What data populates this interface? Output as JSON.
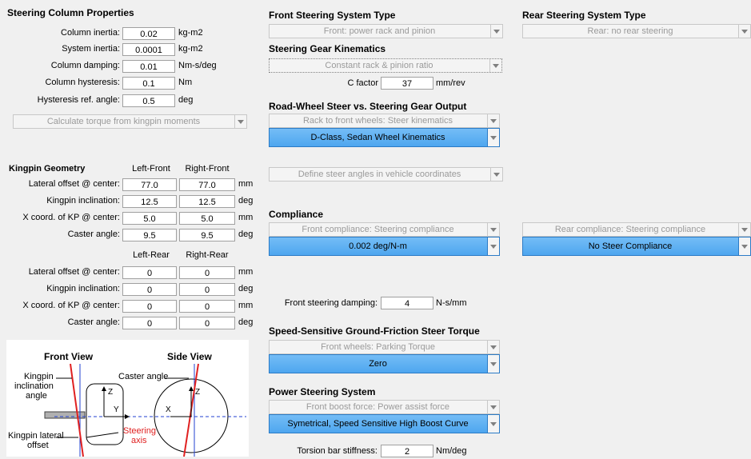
{
  "column": {
    "title": "Steering Column Properties",
    "rows": [
      {
        "label": "Column inertia:",
        "value": "0.02",
        "unit": "kg-m2"
      },
      {
        "label": "System inertia:",
        "value": "0.0001",
        "unit": "kg-m2"
      },
      {
        "label": "Column damping:",
        "value": "0.01",
        "unit": "Nm-s/deg"
      },
      {
        "label": "Column hysteresis:",
        "value": "0.1",
        "unit": "Nm"
      },
      {
        "label": "Hysteresis ref. angle:",
        "value": "0.5",
        "unit": "deg"
      }
    ],
    "torque_dropdown": "Calculate torque from kingpin moments"
  },
  "kingpin": {
    "title": "Kingpin Geometry",
    "front_headers": [
      "Left-Front",
      "Right-Front"
    ],
    "rear_headers": [
      "Left-Rear",
      "Right-Rear"
    ],
    "front_rows": [
      {
        "label": "Lateral offset @ center:",
        "left": "77.0",
        "right": "77.0",
        "unit": "mm"
      },
      {
        "label": "Kingpin inclination:",
        "left": "12.5",
        "right": "12.5",
        "unit": "deg"
      },
      {
        "label": "X coord. of KP @ center:",
        "left": "5.0",
        "right": "5.0",
        "unit": "mm"
      },
      {
        "label": "Caster angle:",
        "left": "9.5",
        "right": "9.5",
        "unit": "deg"
      }
    ],
    "rear_rows": [
      {
        "label": "Lateral offset @ center:",
        "left": "0",
        "right": "0",
        "unit": "mm"
      },
      {
        "label": "Kingpin inclination:",
        "left": "0",
        "right": "0",
        "unit": "deg"
      },
      {
        "label": "X coord. of KP @ center:",
        "left": "0",
        "right": "0",
        "unit": "mm"
      },
      {
        "label": "Caster angle:",
        "left": "0",
        "right": "0",
        "unit": "deg"
      }
    ]
  },
  "diagram": {
    "front_view": "Front View",
    "side_view": "Side View",
    "kp_incl_1": "Kingpin",
    "kp_incl_2": "inclination",
    "kp_incl_3": "angle",
    "caster": "Caster angle",
    "kp_lat_1": "Kingpin lateral",
    "kp_lat_2": "offset",
    "steer_axis_1": "Steering",
    "steer_axis_2": "axis",
    "z": "Z",
    "y": "Y",
    "x": "X"
  },
  "front_system": {
    "title": "Front Steering System Type",
    "dropdown": "Front: power rack and pinion"
  },
  "gear": {
    "title": "Steering Gear Kinematics",
    "dropdown": "Constant rack & pinion ratio",
    "c_label": "C factor",
    "c_value": "37",
    "c_unit": "mm/rev"
  },
  "roadwheel": {
    "title": "Road-Wheel Steer vs. Steering Gear Output",
    "dropdown": "Rack to front wheels: Steer kinematics",
    "selected": "D-Class, Sedan Wheel Kinematics",
    "angles_dropdown": "Define steer angles in vehicle coordinates"
  },
  "compliance": {
    "title": "Compliance",
    "front_dropdown": "Front compliance: Steering compliance",
    "front_selected": "0.002 deg/N-m",
    "rear_dropdown": "Rear compliance: Steering compliance",
    "rear_selected": "No Steer Compliance"
  },
  "damping": {
    "label": "Front steering damping:",
    "value": "4",
    "unit": "N-s/mm"
  },
  "friction": {
    "title": "Speed-Sensitive Ground-Friction Steer Torque",
    "dropdown": "Front wheels: Parking Torque",
    "selected": "Zero"
  },
  "power": {
    "title": "Power Steering System",
    "dropdown": "Front boost force: Power assist force",
    "selected": "Symetrical, Speed Sensitive High Boost Curve",
    "torsion_label": "Torsion bar stiffness:",
    "torsion_value": "2",
    "torsion_unit": "Nm/deg"
  },
  "rear_system": {
    "title": "Rear Steering System Type",
    "dropdown": "Rear: no rear steering"
  },
  "colors": {
    "selected_blue": "#4ea6ef",
    "diagram_red": "#e02020",
    "diagram_blue": "#2040d0"
  }
}
